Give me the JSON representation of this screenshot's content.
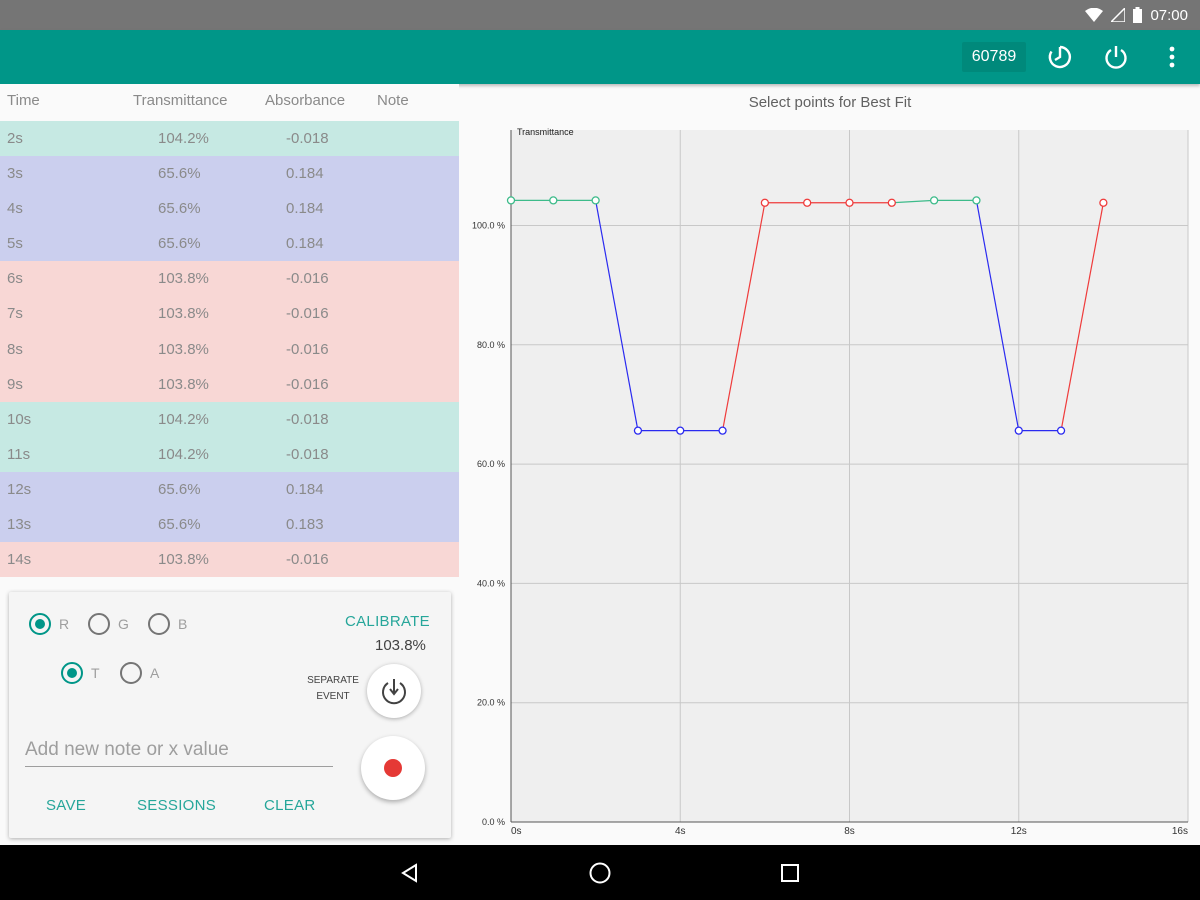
{
  "status_bar": {
    "time": "07:00",
    "icons": [
      "wifi-icon",
      "signal-icon",
      "battery-icon"
    ]
  },
  "app_bar": {
    "device_id": "60789",
    "actions": [
      "timer-icon",
      "power-icon",
      "more-vert-icon"
    ]
  },
  "table": {
    "headers": {
      "time": "Time",
      "transmittance": "Transmittance",
      "absorbance": "Absorbance",
      "note": "Note"
    },
    "rows": [
      {
        "time": "2s",
        "transmittance": "104.2%",
        "absorbance": "-0.018",
        "note": "",
        "group": "green"
      },
      {
        "time": "3s",
        "transmittance": "65.6%",
        "absorbance": "0.184",
        "note": "",
        "group": "blue"
      },
      {
        "time": "4s",
        "transmittance": "65.6%",
        "absorbance": "0.184",
        "note": "",
        "group": "blue"
      },
      {
        "time": "5s",
        "transmittance": "65.6%",
        "absorbance": "0.184",
        "note": "",
        "group": "blue"
      },
      {
        "time": "6s",
        "transmittance": "103.8%",
        "absorbance": "-0.016",
        "note": "",
        "group": "red"
      },
      {
        "time": "7s",
        "transmittance": "103.8%",
        "absorbance": "-0.016",
        "note": "",
        "group": "red"
      },
      {
        "time": "8s",
        "transmittance": "103.8%",
        "absorbance": "-0.016",
        "note": "",
        "group": "red"
      },
      {
        "time": "9s",
        "transmittance": "103.8%",
        "absorbance": "-0.016",
        "note": "",
        "group": "red"
      },
      {
        "time": "10s",
        "transmittance": "104.2%",
        "absorbance": "-0.018",
        "note": "",
        "group": "green"
      },
      {
        "time": "11s",
        "transmittance": "104.2%",
        "absorbance": "-0.018",
        "note": "",
        "group": "green"
      },
      {
        "time": "12s",
        "transmittance": "65.6%",
        "absorbance": "0.184",
        "note": "",
        "group": "blue"
      },
      {
        "time": "13s",
        "transmittance": "65.6%",
        "absorbance": "0.183",
        "note": "",
        "group": "blue"
      },
      {
        "time": "14s",
        "transmittance": "103.8%",
        "absorbance": "-0.016",
        "note": "",
        "group": "red"
      }
    ]
  },
  "controls": {
    "channel_options": [
      {
        "label": "R",
        "selected": true
      },
      {
        "label": "G",
        "selected": false
      },
      {
        "label": "B",
        "selected": false
      }
    ],
    "mode_options": [
      {
        "label": "T",
        "selected": true
      },
      {
        "label": "A",
        "selected": false
      }
    ],
    "calibrate_label": "CALIBRATE",
    "calibrate_value": "103.8%",
    "separate_event_label": "SEPARATE EVENT",
    "note_placeholder": "Add new note or x value",
    "note_value": "",
    "save_label": "SAVE",
    "sessions_label": "SESSIONS",
    "clear_label": "CLEAR"
  },
  "chart_data": {
    "type": "line",
    "title": "Select points for Best Fit",
    "ylabel": "Transmittance",
    "xlabel": "",
    "xlim": [
      0,
      16
    ],
    "ylim": [
      0,
      116
    ],
    "x_tick_labels": [
      "0s",
      "4s",
      "8s",
      "12s",
      "16s"
    ],
    "x_ticks": [
      0,
      4,
      8,
      12,
      16
    ],
    "y_tick_labels": [
      "0.0 %",
      "20.0 %",
      "40.0 %",
      "60.0 %",
      "80.0 %",
      "100.0 %"
    ],
    "y_ticks": [
      0,
      20,
      40,
      60,
      80,
      100
    ],
    "grid": true,
    "background": "#efefef",
    "points": [
      {
        "x": 0,
        "y": 104.2,
        "group": "green"
      },
      {
        "x": 1,
        "y": 104.2,
        "group": "green"
      },
      {
        "x": 2,
        "y": 104.2,
        "group": "green"
      },
      {
        "x": 3,
        "y": 65.6,
        "group": "blue"
      },
      {
        "x": 4,
        "y": 65.6,
        "group": "blue"
      },
      {
        "x": 5,
        "y": 65.6,
        "group": "blue"
      },
      {
        "x": 6,
        "y": 103.8,
        "group": "red"
      },
      {
        "x": 7,
        "y": 103.8,
        "group": "red"
      },
      {
        "x": 8,
        "y": 103.8,
        "group": "red"
      },
      {
        "x": 9,
        "y": 103.8,
        "group": "red"
      },
      {
        "x": 10,
        "y": 104.2,
        "group": "green"
      },
      {
        "x": 11,
        "y": 104.2,
        "group": "green"
      },
      {
        "x": 12,
        "y": 65.6,
        "group": "blue"
      },
      {
        "x": 13,
        "y": 65.6,
        "group": "blue"
      },
      {
        "x": 14,
        "y": 103.8,
        "group": "red"
      }
    ],
    "group_colors": {
      "green": "#3dbb8a",
      "blue": "#2a2af0",
      "red": "#ef3b3b"
    }
  },
  "nav_bar": {
    "buttons": [
      "back-icon",
      "home-icon",
      "recents-icon"
    ]
  },
  "colors": {
    "primary": "#009688",
    "accent": "#26a69a",
    "record": "#e53935"
  }
}
